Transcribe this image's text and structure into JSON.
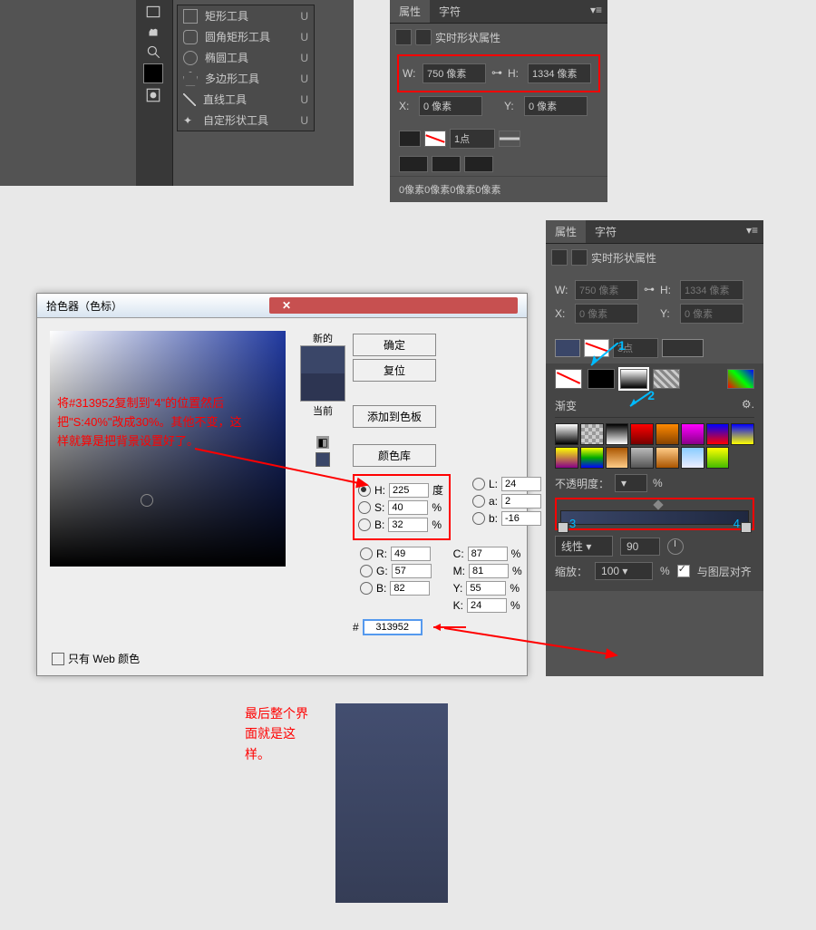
{
  "shape_tools": [
    {
      "label": "矩形工具",
      "key": "U"
    },
    {
      "label": "圆角矩形工具",
      "key": "U"
    },
    {
      "label": "椭圆工具",
      "key": "U"
    },
    {
      "label": "多边形工具",
      "key": "U"
    },
    {
      "label": "直线工具",
      "key": "U"
    },
    {
      "label": "自定形状工具",
      "key": "U"
    }
  ],
  "props1": {
    "tab1": "属性",
    "tab2": "字符",
    "title": "实时形状属性",
    "W_lbl": "W:",
    "W": "750 像素",
    "H_lbl": "H:",
    "H": "1334 像素",
    "X_lbl": "X:",
    "X": "0 像素",
    "Y_lbl": "Y:",
    "Y": "0 像素",
    "stroke": "1点",
    "corners": "0像素0像素0像素0像素"
  },
  "picker": {
    "title": "拾色器（色标）",
    "ok": "确定",
    "reset": "复位",
    "add": "添加到色板",
    "lib": "颜色库",
    "new_lbl": "新的",
    "cur_lbl": "当前",
    "H_lbl": "H:",
    "H": "225",
    "H_u": "度",
    "S_lbl": "S:",
    "S": "40",
    "S_u": "%",
    "B_lbl": "B:",
    "B": "32",
    "B_u": "%",
    "R_lbl": "R:",
    "R": "49",
    "G_lbl": "G:",
    "G": "57",
    "Bb_lbl": "B:",
    "Bb": "82",
    "L_lbl": "L:",
    "L": "24",
    "a_lbl": "a:",
    "a": "2",
    "b_lbl": "b:",
    "b": "-16",
    "C_lbl": "C:",
    "C": "87",
    "pct": "%",
    "M_lbl": "M:",
    "M": "81",
    "Yc_lbl": "Y:",
    "Yc": "55",
    "K_lbl": "K:",
    "K": "24",
    "hex_lbl": "#",
    "hex": "313952",
    "web": "只有 Web 颜色"
  },
  "annotation1": "将#313952复制到\"4\"的位置然后把\"S:40%\"改成30%。其他不变，这样就算是把背景设置好了。",
  "props2": {
    "tab1": "属性",
    "tab2": "字符",
    "title": "实时形状属性",
    "W_lbl": "W:",
    "W": "750 像素",
    "H_lbl": "H:",
    "H": "1334 像素",
    "X_lbl": "X:",
    "X": "0 像素",
    "Y_lbl": "Y:",
    "Y": "0 像素",
    "stroke": "3点",
    "grad_title": "渐变",
    "opac_lbl": "不透明度：",
    "opac_u": "%",
    "num3": "3",
    "num4": "4",
    "type": "线性",
    "angle": "90",
    "scale_lbl": "缩放：",
    "scale": "100",
    "align": "与图层对齐",
    "call1": "1",
    "call2": "2"
  },
  "final": {
    "text": "最后整个界面就是这样。"
  }
}
